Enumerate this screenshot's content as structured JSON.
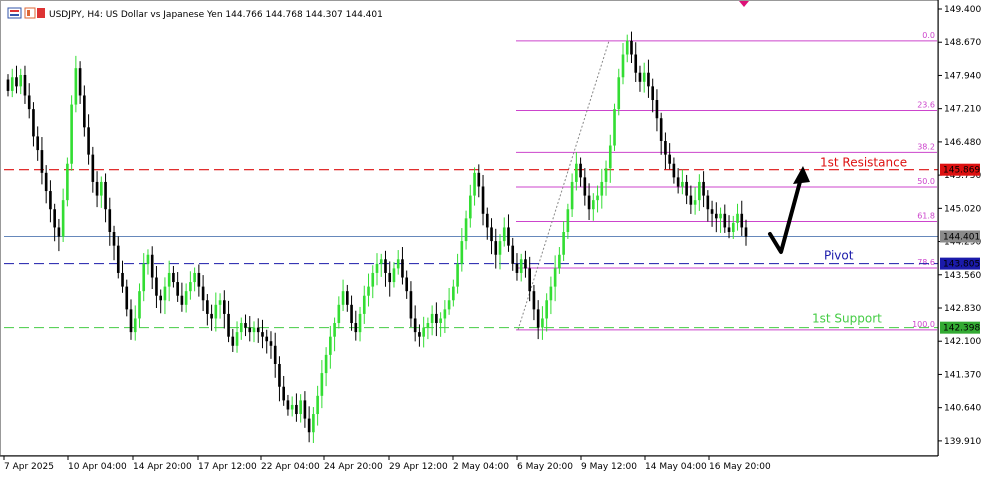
{
  "window": {
    "title": "USDJPY, H4:  US Dollar vs Japanese Yen  144.766 144.768 144.307 144.401"
  },
  "colors": {
    "bull": "#33dd33",
    "bear": "#000000",
    "fib": "#cc44cc",
    "resistance": "#dd1111",
    "pivot": "#1a1aaa",
    "support": "#44cc44",
    "current": "#6688bb"
  },
  "axis": {
    "price_ticks": [
      "149.400",
      "148.670",
      "147.940",
      "147.210",
      "146.480",
      "145.750",
      "145.020",
      "144.290",
      "143.560",
      "142.830",
      "142.100",
      "141.370",
      "140.640",
      "139.910"
    ],
    "time_ticks": [
      "7 Apr 2025",
      "10 Apr 04:00",
      "14 Apr 20:00",
      "17 Apr 12:00",
      "22 Apr 04:00",
      "24 Apr 20:00",
      "29 Apr 12:00",
      "2 May 04:00",
      "6 May 20:00",
      "9 May 12:00",
      "14 May 04:00",
      "16 May 20:00"
    ]
  },
  "fib_labels": [
    "0.0",
    "23.6",
    "38.2",
    "50.0",
    "61.8",
    "78.6",
    "100.0"
  ],
  "levels": {
    "resistance_label": "1st Resistance",
    "pivot_label": "Pivot",
    "support_label": "1st Support",
    "resistance_price": "145.869",
    "pivot_price": "143.805",
    "support_price": "142.398",
    "current_price": "144.401"
  },
  "chart_data": {
    "type": "candlestick",
    "symbol": "USDJPY",
    "timeframe": "H4",
    "ylim": [
      139.6,
      149.55
    ],
    "fib_levels": [
      {
        "ratio": "0.0",
        "price": 148.7
      },
      {
        "ratio": "23.6",
        "price": 147.17
      },
      {
        "ratio": "38.2",
        "price": 146.25
      },
      {
        "ratio": "50.0",
        "price": 145.49
      },
      {
        "ratio": "61.8",
        "price": 144.73
      },
      {
        "ratio": "78.6",
        "price": 143.71
      },
      {
        "ratio": "100.0",
        "price": 142.35
      }
    ],
    "horizontal_lines": [
      {
        "name": "1st Resistance",
        "price": 145.869
      },
      {
        "name": "Pivot",
        "price": 143.805
      },
      {
        "name": "1st Support",
        "price": 142.398
      },
      {
        "name": "current",
        "price": 144.401
      }
    ],
    "closes": [
      147.6,
      147.9,
      147.7,
      147.95,
      147.5,
      147.2,
      146.6,
      146.3,
      145.8,
      145.4,
      145.0,
      144.6,
      144.4,
      145.2,
      146.0,
      147.3,
      148.1,
      147.5,
      146.8,
      146.2,
      145.6,
      145.3,
      145.6,
      145.0,
      144.5,
      144.2,
      143.6,
      143.3,
      142.8,
      142.3,
      142.6,
      143.2,
      143.8,
      144.0,
      143.5,
      143.1,
      143.0,
      143.3,
      143.6,
      143.4,
      143.1,
      142.9,
      143.2,
      143.4,
      143.6,
      143.3,
      143.0,
      142.7,
      142.6,
      142.9,
      143.0,
      142.7,
      142.2,
      142.0,
      142.3,
      142.5,
      142.4,
      142.3,
      142.4,
      142.3,
      142.2,
      142.1,
      142.0,
      141.6,
      141.1,
      140.8,
      140.6,
      140.7,
      140.5,
      140.8,
      140.4,
      140.1,
      140.5,
      140.9,
      141.4,
      141.8,
      142.2,
      142.5,
      142.9,
      143.2,
      142.9,
      142.5,
      142.3,
      142.7,
      143.1,
      143.3,
      143.6,
      143.8,
      143.9,
      143.6,
      143.4,
      143.7,
      143.9,
      143.5,
      143.2,
      142.6,
      142.3,
      142.2,
      142.4,
      142.5,
      142.7,
      142.5,
      142.6,
      142.8,
      143.0,
      143.3,
      143.8,
      144.3,
      144.8,
      145.3,
      145.8,
      145.5,
      144.9,
      144.6,
      144.3,
      144.0,
      144.3,
      144.6,
      144.2,
      143.8,
      143.6,
      143.9,
      143.7,
      143.2,
      142.8,
      142.4,
      142.6,
      143.0,
      143.3,
      143.7,
      144.0,
      144.5,
      145.0,
      145.6,
      146.0,
      145.7,
      145.3,
      145.0,
      145.2,
      145.3,
      145.6,
      145.9,
      146.4,
      147.2,
      147.9,
      148.4,
      148.7,
      148.4,
      148.0,
      147.8,
      148.0,
      147.7,
      147.4,
      147.0,
      146.5,
      146.2,
      146.0,
      145.7,
      145.5,
      145.6,
      145.3,
      145.1,
      145.2,
      145.6,
      145.3,
      145.0,
      144.9,
      144.8,
      144.9,
      144.6,
      144.5,
      144.7,
      144.9,
      144.6,
      144.4
    ]
  }
}
